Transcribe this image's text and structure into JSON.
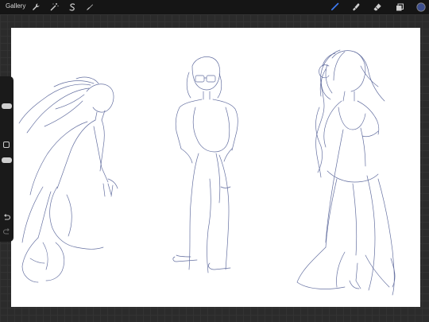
{
  "topbar": {
    "gallery_label": "Gallery"
  },
  "icons": {
    "actions": "wrench-icon",
    "adjustments": "magic-wand-icon",
    "selection": "selection-s-icon",
    "transform": "arrow-cursor-icon",
    "brush": "brush-icon",
    "smudge": "smudge-icon",
    "eraser": "eraser-icon",
    "layers": "layers-icon",
    "color": "color-swatch-icon",
    "undo": "undo-icon",
    "redo": "redo-icon"
  },
  "colors": {
    "active_tool": "#3d7bf5",
    "current_color": "#3d4f8f",
    "sketch_stroke": "#4a5790"
  }
}
